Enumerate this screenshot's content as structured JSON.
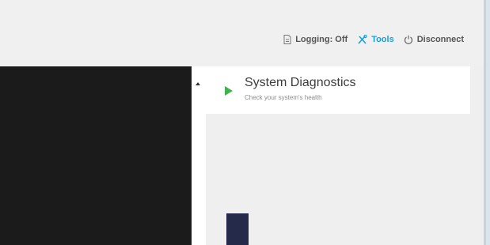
{
  "toolbar": {
    "logging_label": "Logging: Off",
    "tools_label": "Tools",
    "disconnect_label": "Disconnect"
  },
  "panel": {
    "title": "System Diagnostics",
    "subtitle": "Check your system's health"
  },
  "icons": {
    "logging": "document-icon",
    "tools": "tools-icon",
    "disconnect": "power-icon",
    "diagnostics": "play-icon",
    "scroll": "scroll-up-arrow-icon"
  },
  "colors": {
    "accent": "#1aa0d8",
    "play_green": "#3fb34f",
    "console_bg": "#1b1b1b",
    "bar": "#262a4a"
  }
}
